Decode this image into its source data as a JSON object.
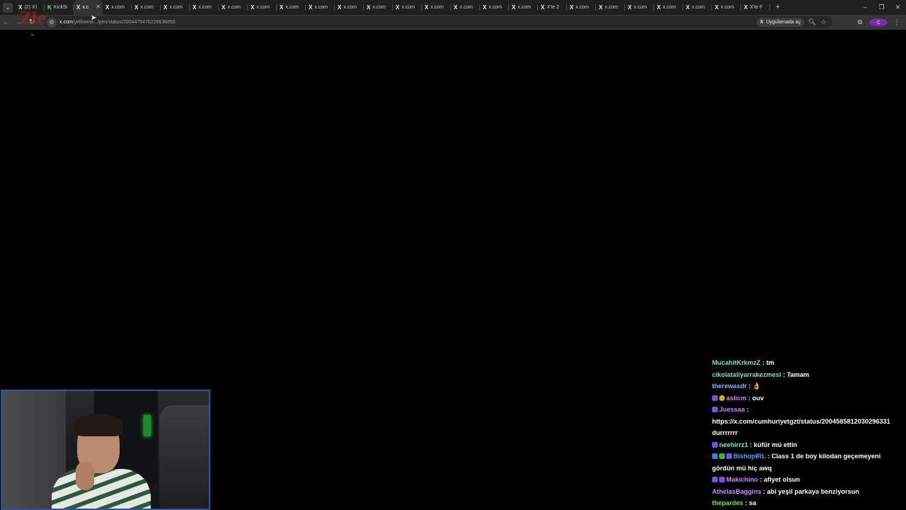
{
  "browser": {
    "tabs": [
      {
        "favicon": "x-logo",
        "label": "(2) X'i",
        "active": false
      },
      {
        "favicon": "kick-logo",
        "label": "KickSi",
        "active": false
      },
      {
        "favicon": "x-logo",
        "label": "x.c",
        "active": true
      },
      {
        "favicon": "x-logo",
        "label": "x.com",
        "active": false
      },
      {
        "favicon": "x-logo",
        "label": "x.com",
        "active": false
      },
      {
        "favicon": "x-logo",
        "label": "x.com",
        "active": false
      },
      {
        "favicon": "x-logo",
        "label": "x.com",
        "active": false
      },
      {
        "favicon": "x-logo",
        "label": "x.com",
        "active": false
      },
      {
        "favicon": "x-logo",
        "label": "x.com",
        "active": false
      },
      {
        "favicon": "x-logo",
        "label": "x.com",
        "active": false
      },
      {
        "favicon": "x-logo",
        "label": "x.com",
        "active": false
      },
      {
        "favicon": "x-logo",
        "label": "x.com",
        "active": false
      },
      {
        "favicon": "x-logo",
        "label": "x.com",
        "active": false
      },
      {
        "favicon": "x-logo",
        "label": "x.com",
        "active": false
      },
      {
        "favicon": "x-logo",
        "label": "x.com",
        "active": false
      },
      {
        "favicon": "x-logo",
        "label": "x.com",
        "active": false
      },
      {
        "favicon": "x-logo",
        "label": "x.com",
        "active": false
      },
      {
        "favicon": "x-logo",
        "label": "x.com",
        "active": false
      },
      {
        "favicon": "x-logo",
        "label": "X'te 2",
        "active": false
      },
      {
        "favicon": "x-logo",
        "label": "x.com",
        "active": false
      },
      {
        "favicon": "x-logo",
        "label": "x.com",
        "active": false
      },
      {
        "favicon": "x-logo",
        "label": "x.com",
        "active": false
      },
      {
        "favicon": "x-logo",
        "label": "x.com",
        "active": false
      },
      {
        "favicon": "x-logo",
        "label": "x.com",
        "active": false
      },
      {
        "favicon": "x-logo",
        "label": "x.com",
        "active": false
      },
      {
        "favicon": "x-logo",
        "label": "X'te F",
        "active": false
      }
    ],
    "address_bar": {
      "host": "x.com",
      "path": "/yellowna.../pen/status/2004475476228636856"
    },
    "open_in_app_label": "Uygulamada aç",
    "window_controls": {
      "minimize": "–",
      "restore": "❐",
      "close": "✕"
    }
  },
  "stream_overlay": {
    "logo_text": "ZIe",
    "tilde": "~"
  },
  "chat": {
    "messages": [
      {
        "user": "MucahitKrkmzZ",
        "color": "#7ee0c6",
        "text": "tm",
        "badges": []
      },
      {
        "user": "cikolataliyarrakezmesi",
        "color": "#7ee0c6",
        "text": "Tamam",
        "badges": []
      },
      {
        "user": "therewasdr",
        "color": "#8fb3ff",
        "text": "👌",
        "badges": []
      },
      {
        "user": "aslicm",
        "color": "#c58bff",
        "text": "ouv",
        "badges": [
          "sub",
          "coin"
        ]
      },
      {
        "user": "Juessaa",
        "color": "#c58bff",
        "text": "",
        "badges": [
          "sub"
        ],
        "continuation": "https://x.com/cumhuriyetgzt/status/2004585812030296331 durrrrrrr"
      },
      {
        "user": "neehirrz1",
        "color": "#7ee0c6",
        "text": "küfür mü ettin",
        "badges": [
          "sub"
        ]
      },
      {
        "user": "BishopIRL",
        "color": "#4aa3ff",
        "text": "Class 1 de boy kilodan geçemeyeni gördün mü hiç awq",
        "badges": [
          "mod",
          "verified",
          "sub"
        ]
      },
      {
        "user": "Makichino",
        "color": "#c58bff",
        "text": "afiyet olsun",
        "badges": [
          "sub",
          "sub"
        ]
      },
      {
        "user": "AthelasBaggins",
        "color": "#c58bff",
        "text": "abi yeşil parkaya benziyorsun",
        "badges": []
      },
      {
        "user": "thepardes",
        "color": "#7fe04a",
        "text": "sa",
        "badges": []
      }
    ]
  },
  "colors": {
    "tabstrip_bg": "#1f1f1f",
    "toolbar_bg": "#353535",
    "webcam_border": "#1e58a8",
    "page_bg": "#000000"
  }
}
